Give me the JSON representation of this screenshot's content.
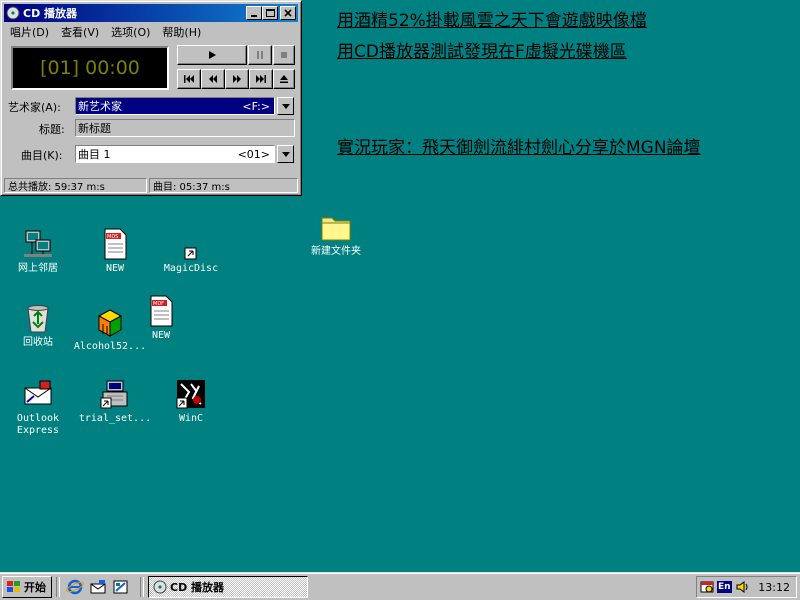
{
  "window": {
    "title": "CD 播放器",
    "menus": [
      "唱片(D)",
      "查看(V)",
      "选项(O)",
      "帮助(H)"
    ],
    "display": "[01] 00:00",
    "artist_label": "艺术家(A):",
    "artist_value": "新艺术家",
    "artist_drive": "<F:>",
    "title_label": "标题:",
    "title_value": "新标题",
    "track_label": "曲目(K):",
    "track_value": "曲目 1",
    "track_number": "<01>",
    "status_total": "总共播放: 59:37 m:s",
    "status_track": "曲目: 05:37 m:s",
    "colors": {
      "lcd_text": "#7f7f00",
      "titlebar": "#000080",
      "selected": "#000080"
    }
  },
  "desktop": {
    "background": "#008080",
    "icons": [
      {
        "label": "网上邻居",
        "icon": "network-neighborhood-icon"
      },
      {
        "label": "NEW",
        "icon": "mds-file-icon"
      },
      {
        "label": "MagicDisc",
        "icon": "shortcut-icon"
      },
      {
        "label": "新建文件夹",
        "icon": "folder-icon"
      },
      {
        "label": "回收站",
        "icon": "recycle-bin-icon"
      },
      {
        "label": "Alcohol52...",
        "icon": "alcohol-icon"
      },
      {
        "label": "NEW",
        "icon": "mdf-file-icon"
      },
      {
        "label": "Outlook\nExpress",
        "icon": "outlook-express-icon"
      },
      {
        "label": "trial_set...",
        "icon": "setup-icon"
      },
      {
        "label": "WinC",
        "icon": "winc-icon"
      }
    ]
  },
  "overlay": {
    "line1": "用酒精52%掛載風雲之天下會遊戲映像檔",
    "line2": "用CD播放器測試發現在F虛擬光碟機區",
    "line3": "實況玩家：飛天御劍流緋村劍心分享於MGN論壇"
  },
  "taskbar": {
    "start_label": "开始",
    "task_label": "CD 播放器",
    "tray_lang": "En",
    "clock": "13:12"
  }
}
